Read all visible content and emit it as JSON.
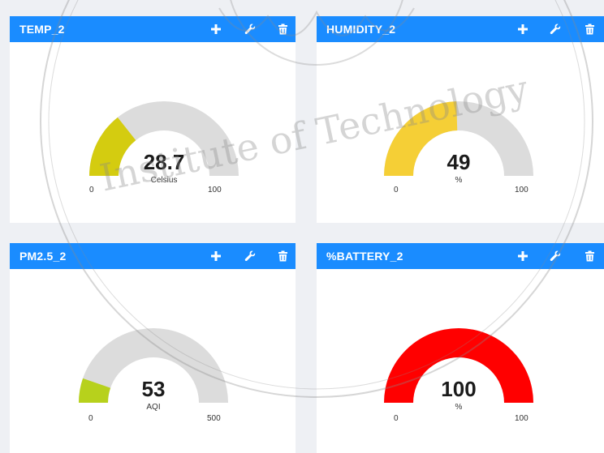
{
  "colors": {
    "header_blue": "#1a8cff",
    "gauge_track": "#dcdcdc",
    "temp_fill": "#d4cc10",
    "humidity_fill": "#f5cf36",
    "pm25_fill": "#b7d11c",
    "battery_fill": "#ff0000"
  },
  "watermark": {
    "text": "Institute of Technology"
  },
  "panels": [
    {
      "title": "TEMP_2",
      "value": "28.7",
      "unit": "Celsius",
      "min": "0",
      "max": "100",
      "fraction": 0.287,
      "fill_color_key": "temp_fill"
    },
    {
      "title": "HUMIDITY_2",
      "value": "49",
      "unit": "%",
      "min": "0",
      "max": "100",
      "fraction": 0.49,
      "fill_color_key": "humidity_fill"
    },
    {
      "title": "PM2.5_2",
      "value": "53",
      "unit": "AQI",
      "min": "0",
      "max": "500",
      "fraction": 0.106,
      "fill_color_key": "pm25_fill"
    },
    {
      "title": "%BATTERY_2",
      "value": "100",
      "unit": "%",
      "min": "0",
      "max": "100",
      "fraction": 1.0,
      "fill_color_key": "battery_fill"
    }
  ],
  "icons": {
    "add": "plus-icon",
    "settings": "wrench-icon",
    "delete": "trash-icon"
  }
}
